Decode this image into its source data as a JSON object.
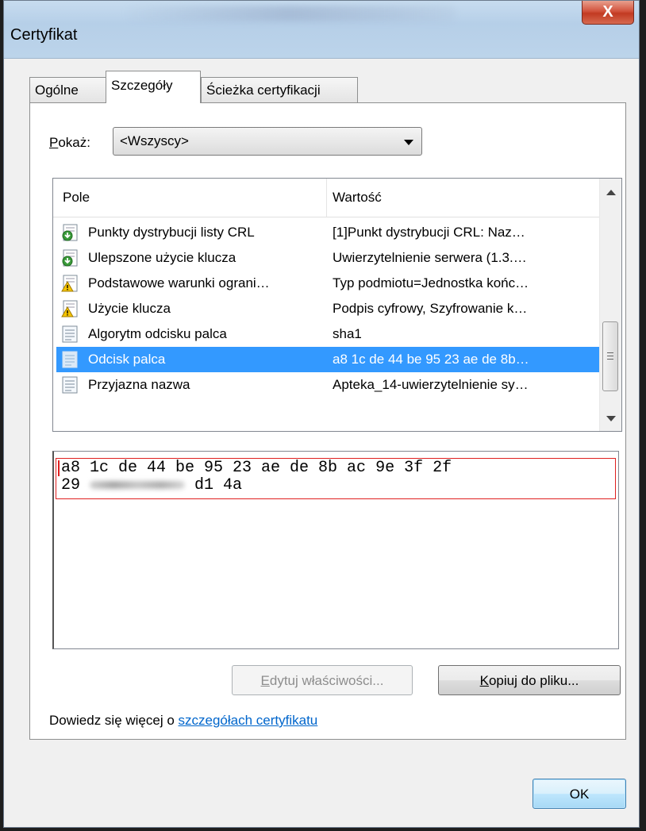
{
  "window": {
    "title": "Certyfikat",
    "close_glyph": "X"
  },
  "tabs": [
    {
      "label": "Ogólne",
      "active": false
    },
    {
      "label": "Szczegóły",
      "active": true
    },
    {
      "label": "Ścieżka certyfikacji",
      "active": false
    }
  ],
  "show": {
    "label_prefix": "P",
    "label_rest": "okaż:",
    "selected": "<Wszyscy>"
  },
  "list": {
    "columns": [
      "Pole",
      "Wartość"
    ],
    "rows": [
      {
        "field": "Punkty dystrybucji listy CRL",
        "value": "[1]Punkt dystrybucji CRL: Naz…",
        "icon": "extension-icon"
      },
      {
        "field": "Ulepszone użycie klucza",
        "value": "Uwierzytelnienie serwera (1.3.…",
        "icon": "extension-icon"
      },
      {
        "field": "Podstawowe warunki ograni…",
        "value": "Typ podmiotu=Jednostka końc…",
        "icon": "critical-extension-icon"
      },
      {
        "field": "Użycie klucza",
        "value": "Podpis cyfrowy, Szyfrowanie k…",
        "icon": "critical-extension-icon"
      },
      {
        "field": "Algorytm odcisku palca",
        "value": "sha1",
        "icon": "property-icon"
      },
      {
        "field": "Odcisk palca",
        "value": "a8 1c de 44 be 95 23 ae de 8b…",
        "icon": "property-icon",
        "selected": true
      },
      {
        "field": "Przyjazna nazwa",
        "value": "Apteka_14-uwierzytelnienie sy…",
        "icon": "property-icon"
      }
    ]
  },
  "detail": {
    "line1": "a8 1c de 44 be 95 23 ae de 8b ac 9e 3f 2f",
    "line2_start": "29 ",
    "line2_end": " d1 4a"
  },
  "buttons": {
    "edit_prefix": "E",
    "edit_rest": "dytuj właściwości...",
    "copy_prefix": "K",
    "copy_rest": "opiuj do pliku...",
    "ok": "OK"
  },
  "learn_more": {
    "text": "Dowiedz się więcej o ",
    "link": "szczegółach certyfikatu"
  }
}
